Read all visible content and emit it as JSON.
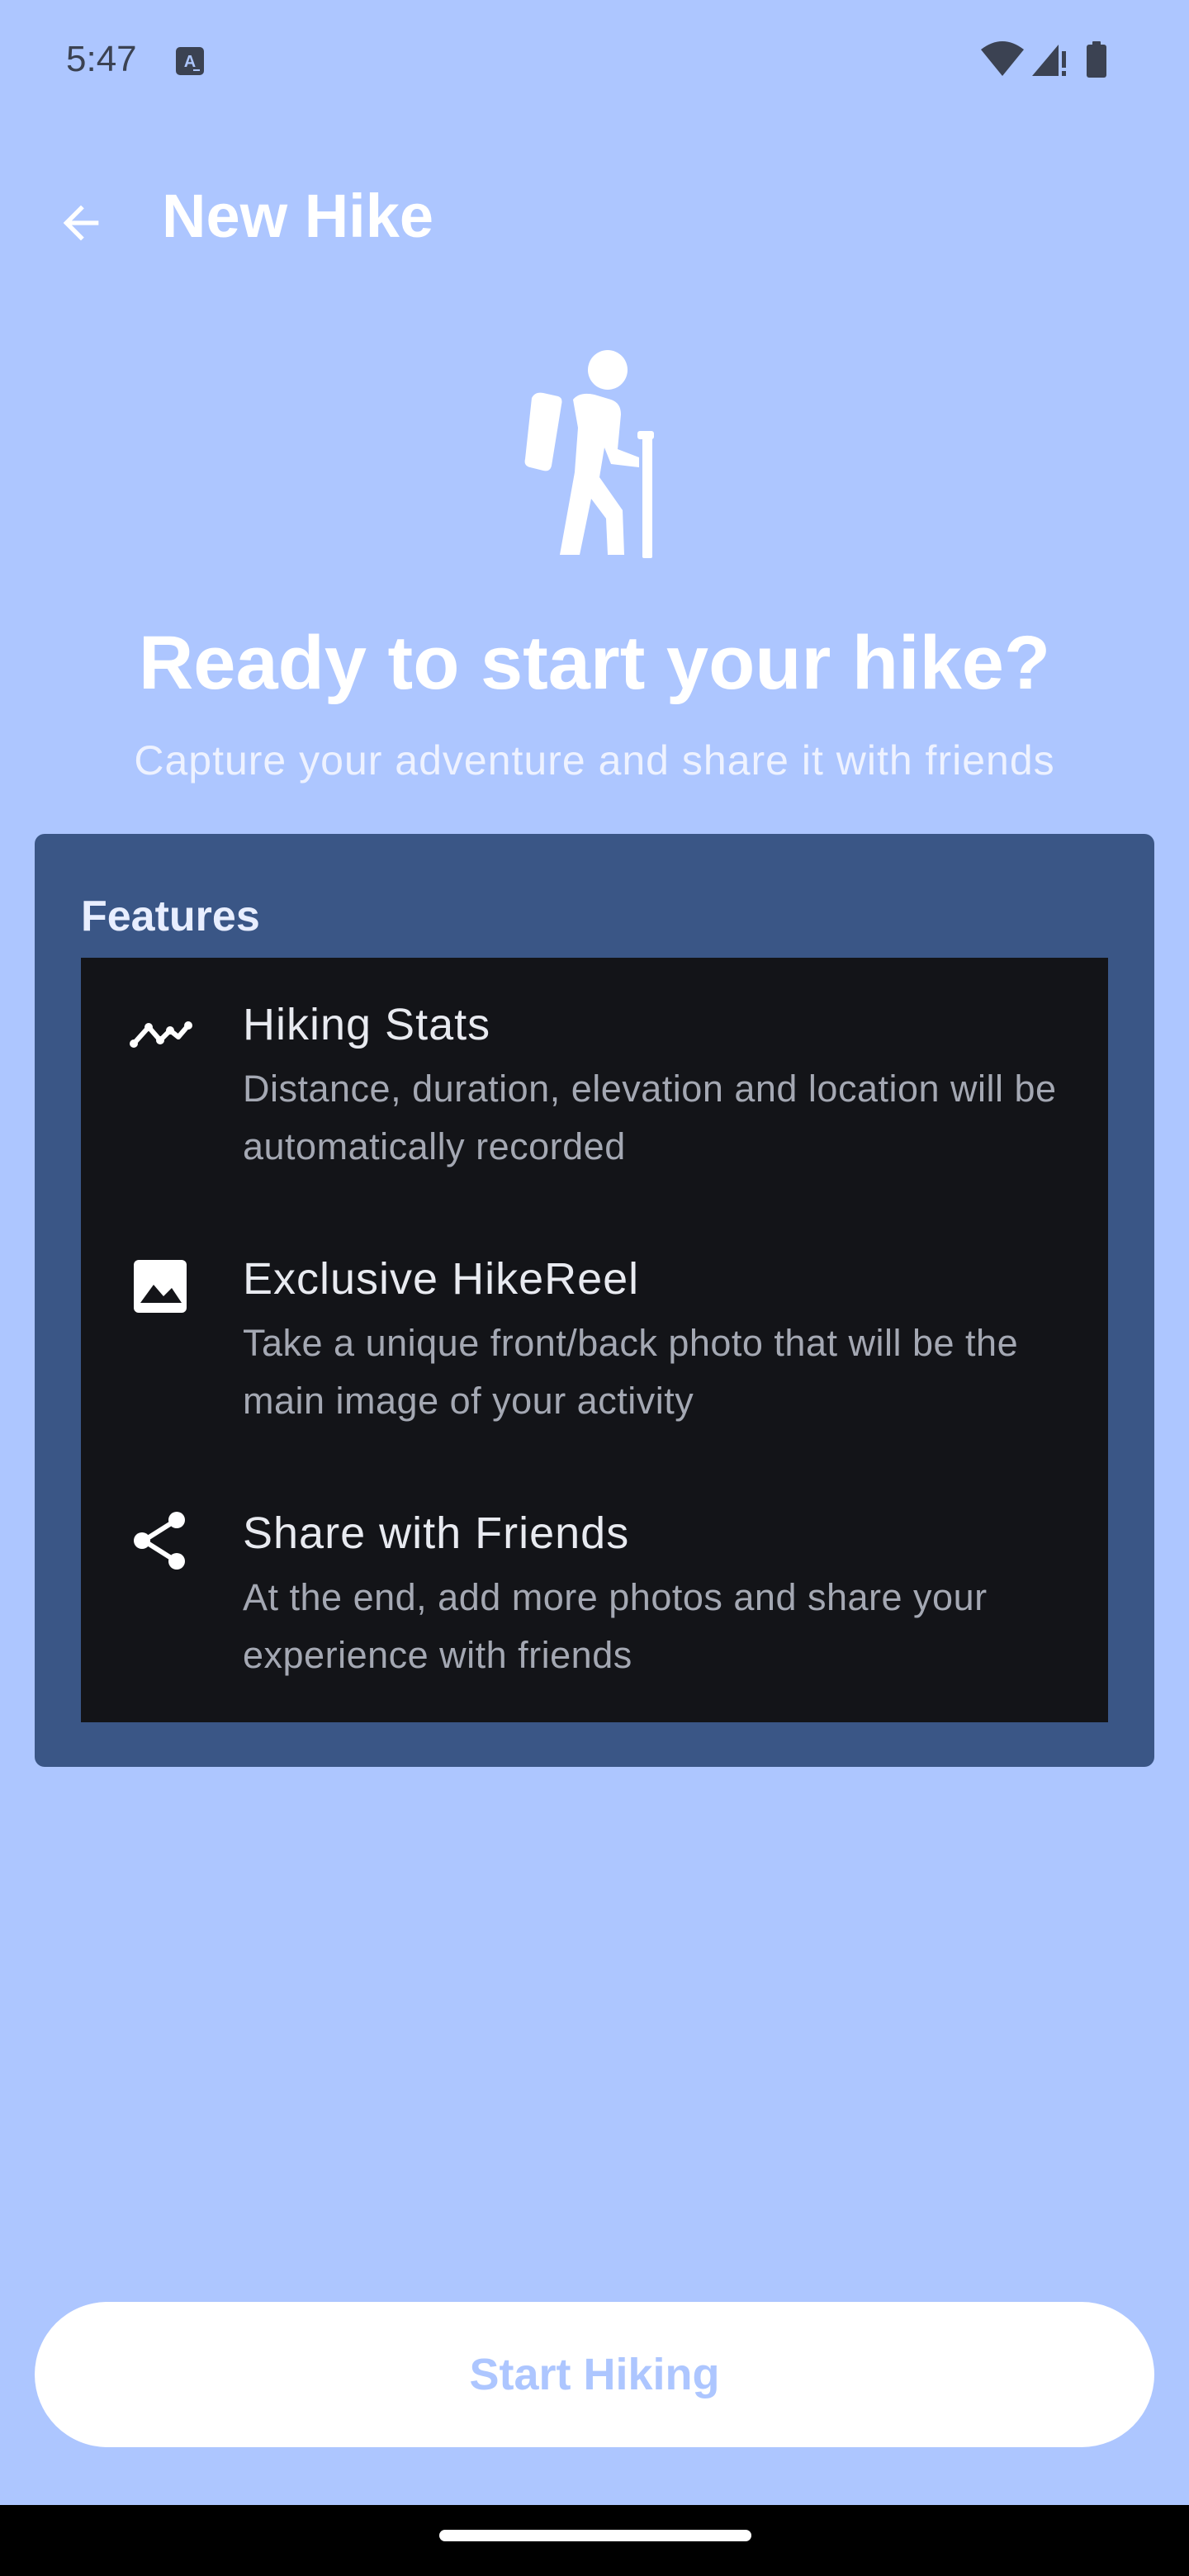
{
  "status_bar": {
    "time": "5:47",
    "icons": [
      "accessibility-a-icon",
      "wifi-icon",
      "signal-icon",
      "battery-icon"
    ]
  },
  "app_bar": {
    "back_icon": "arrow-back-icon",
    "title": "New Hike"
  },
  "hero": {
    "icon": "hiker-icon",
    "title": "Ready to start your hike?",
    "subtitle": "Capture your adventure and share it with friends"
  },
  "features": {
    "heading": "Features",
    "items": [
      {
        "icon": "trending-line-icon",
        "title": "Hiking Stats",
        "description": "Distance, duration, elevation and location will be automatically recorded"
      },
      {
        "icon": "image-icon",
        "title": "Exclusive HikeReel",
        "description": "Take a unique front/back photo that will be the main image of your activity"
      },
      {
        "icon": "share-icon",
        "title": "Share with Friends",
        "description": "At the end, add more photos and share your experience with friends"
      }
    ]
  },
  "start_button": {
    "label": "Start Hiking"
  },
  "colors": {
    "background": "#adc6ff",
    "card": "#3a5686",
    "list_background": "#131418",
    "button": "#ffffff",
    "button_text": "#adc6ff"
  }
}
